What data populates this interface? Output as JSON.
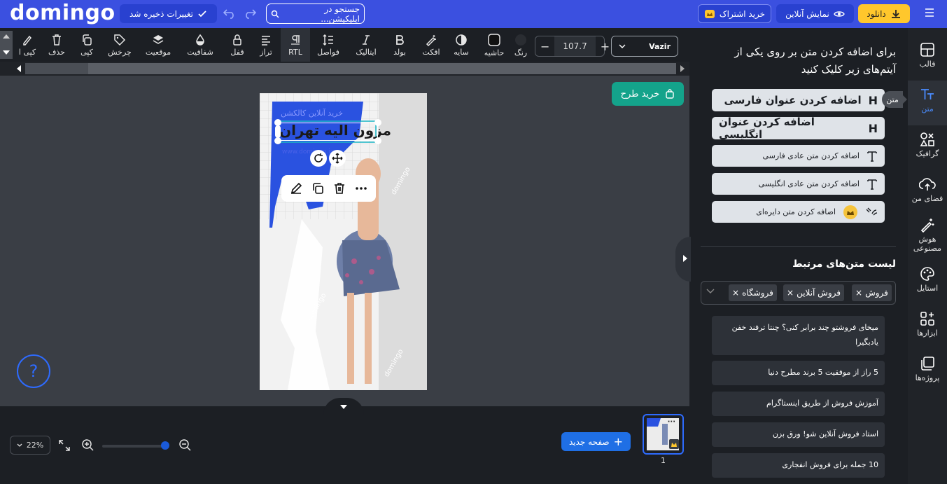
{
  "header": {
    "logo": "domingo",
    "saved_label": "تغییرات ذخیره شد",
    "search_placeholder": "جستجو در اپلیکیشن...",
    "subscribe_label": "خرید اشتراک",
    "preview_label": "نمایش آنلاین",
    "download_label": "دانلود"
  },
  "toolbar": {
    "font_name": "Vazir",
    "font_size": "107.7",
    "tools": [
      {
        "label": "کپی ا",
        "icon": "copy-style-icon"
      },
      {
        "label": "حذف",
        "icon": "trash-icon"
      },
      {
        "label": "کپی",
        "icon": "copy-icon"
      },
      {
        "label": "چرخش",
        "icon": "rotate-tag-icon"
      },
      {
        "label": "موقعیت",
        "icon": "layers-icon"
      },
      {
        "label": "شفافیت",
        "icon": "opacity-drop-icon"
      },
      {
        "label": "قفل",
        "icon": "lock-icon"
      },
      {
        "label": "تراز",
        "icon": "align-icon"
      },
      {
        "label": "RTL",
        "icon": "rtl-icon"
      },
      {
        "label": "فواصل",
        "icon": "spacing-icon"
      },
      {
        "label": "ایتالیک",
        "icon": "italic-icon"
      },
      {
        "label": "بولد",
        "icon": "bold-icon"
      },
      {
        "label": "افکت",
        "icon": "magic-wand-icon"
      },
      {
        "label": "سایه",
        "icon": "shadow-icon"
      },
      {
        "label": "حاشیه",
        "icon": "border-icon"
      },
      {
        "label": "رنگ",
        "icon": "color-swatch-icon"
      }
    ]
  },
  "canvas": {
    "buy_design_label": "خرید طرح",
    "help_label": "?",
    "poster_text_main": "مزون الیه تهران",
    "poster_text_top": "خرید آنلاین کالکشن",
    "poster_text_small": "www.domingo.ir",
    "watermark": "domingo"
  },
  "bottom": {
    "zoom_level": "22%",
    "new_page_label": "صفحه جدید",
    "page_number": "1"
  },
  "panel": {
    "instruction": "برای اضافه کردن متن بر روی یکی از آیتم‌های زیر کلیک کنید",
    "add_buttons": [
      "اضافه کردن عنوان فارسی",
      "اضافه کردن عنوان انگلیسی",
      "اضافه کردن متن عادی فارسی",
      "اضافه کردن متن عادی انگلیسی",
      "اضافه کردن متن دایره‌ای"
    ],
    "related_title": "لیست متن‌های مرتبط",
    "tags": [
      "فروش",
      "فروش آنلاین",
      "فروشگاه"
    ],
    "related_items": [
      "میخای فروشتو چند برابر کنی؟ چنتا ترفند خفن یادبگیرا",
      "5 راز از موفقیت 5 برند مطرح دنیا",
      "آموزش فروش از طریق اینستاگرام",
      "استاد فروش آنلاین شو! ورق بزن",
      "10 جمله برای فروش انفجاری"
    ]
  },
  "sidebar": {
    "tooltip": "متن",
    "items": [
      "قالب",
      "متن",
      "گرافیک",
      "فضای من",
      "هوش مصنوعی",
      "استایل",
      "ابزارها",
      "پروژه‌ها"
    ]
  },
  "colors": {
    "brand": "#3b50e0",
    "accent_yellow": "#ffc72c",
    "teal": "#14a38b",
    "blue_button": "#1f6fe5"
  }
}
